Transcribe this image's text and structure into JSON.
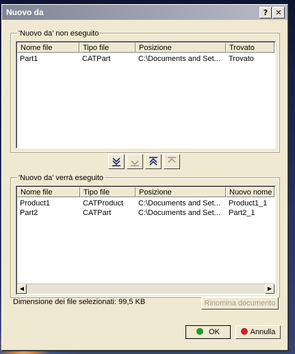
{
  "window": {
    "title": "Nuovo da"
  },
  "titlebar_buttons": {
    "help": "?",
    "close": "✕"
  },
  "group_not_done": {
    "title": "'Nuovo da' non eseguito",
    "columns": [
      "Nome file",
      "Tipo file",
      "Posizione",
      "Trovato"
    ],
    "rows": [
      [
        "Part1",
        "CATPart",
        "C:\\Documents and Set...",
        "Trovato"
      ]
    ]
  },
  "group_will_do": {
    "title": "'Nuovo da' verrà eseguito",
    "columns": [
      "Nome file",
      "Tipo file",
      "Posizione",
      "Nuovo nome"
    ],
    "rows": [
      [
        "Product1",
        "CATProduct",
        "C:\\Documents and Set...",
        "Product1_1"
      ],
      [
        "Part2",
        "CATPart",
        "C:\\Documents and Set...",
        "Part2_1"
      ]
    ]
  },
  "status": {
    "size_text": "Dimensione dei file selezionati: 99,5 KB"
  },
  "buttons": {
    "rename": "Rinomina documento",
    "ok": "OK",
    "cancel": "Annulla"
  },
  "colors": {
    "ok_icon": "#1e9a2c",
    "cancel_icon": "#c8202a",
    "disabled_text": "#a09a8a"
  }
}
